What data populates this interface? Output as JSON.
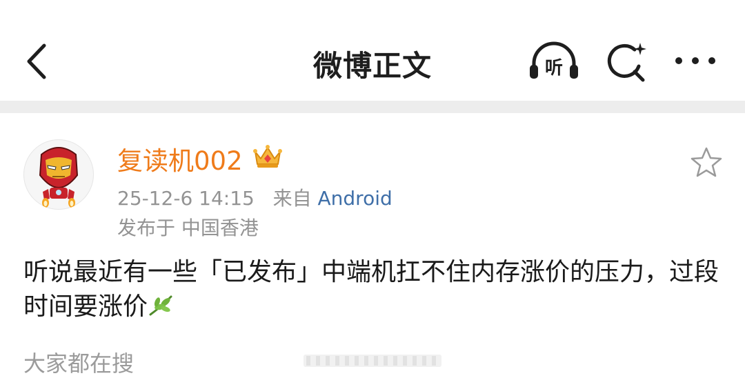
{
  "header": {
    "title": "微博正文",
    "listen_label": "听"
  },
  "post": {
    "username": "复读机002",
    "time": "25-12-6 14:15",
    "source_prefix": "来自",
    "source": "Android",
    "location": "发布于 中国香港",
    "text": "听说最近有一些「已发布」中端机扛不住内存涨价的压力，过段时间要涨价"
  },
  "footer": {
    "search_label": "大家都在搜"
  },
  "colors": {
    "username": "#ef7b1a",
    "source_link": "#3f6fa8",
    "meta": "#939393",
    "divider": "#ededed"
  },
  "icons": {
    "back": "chevron-left-icon",
    "listen": "headphones-icon",
    "search": "search-sparkle-icon",
    "more": "more-dots-icon",
    "crown": "crown-badge-icon",
    "favorite": "star-outline-icon",
    "leaf": "leaf-emoji-icon"
  }
}
